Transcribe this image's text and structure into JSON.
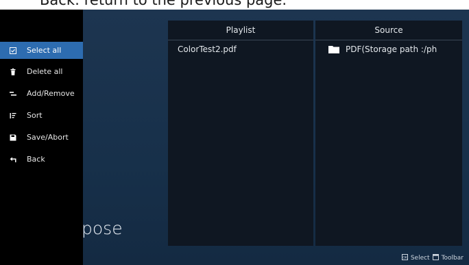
{
  "caption": {
    "text": "Back: return to the previous page."
  },
  "sidebar": {
    "items": [
      {
        "label": "Select all",
        "icon": "checkbox-icon",
        "active": true
      },
      {
        "label": "Delete all",
        "icon": "trash-icon",
        "active": false
      },
      {
        "label": "Add/Remove",
        "icon": "add-remove-icon",
        "active": false
      },
      {
        "label": "Sort",
        "icon": "sort-icon",
        "active": false
      },
      {
        "label": "Save/Abort",
        "icon": "save-icon",
        "active": false
      },
      {
        "label": "Back",
        "icon": "back-icon",
        "active": false
      }
    ]
  },
  "background_text": "pose",
  "playlist": {
    "title": "Playlist",
    "items": [
      "ColorTest2.pdf"
    ]
  },
  "source": {
    "title": "Source",
    "items": [
      {
        "label": "PDF(Storage path :/ph",
        "icon": "folder-icon"
      }
    ]
  },
  "hints": {
    "select_label": "Select",
    "toolbar_label": "Toolbar"
  },
  "colors": {
    "accent": "#2d6cb0",
    "sidebar_bg": "#000000",
    "panel_bg": "#0f1722",
    "screen_bg": "#1d3550"
  }
}
